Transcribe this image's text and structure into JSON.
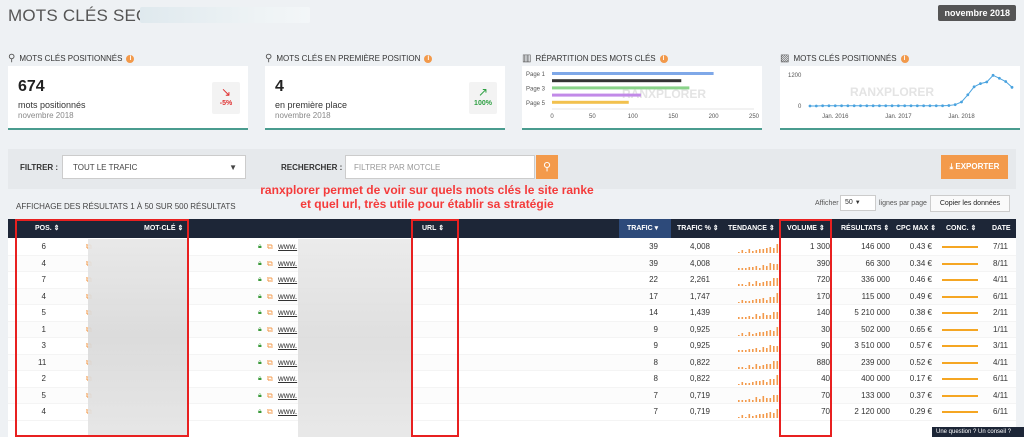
{
  "header": {
    "title": "MOTS CLÉS SEO >",
    "period_badge": "novembre 2018"
  },
  "cards": [
    {
      "title": "MOTS CLÉS POSITIONNÉS",
      "icon": "search-icon",
      "value": "674",
      "label": "mots positionnés",
      "sublabel": "novembre 2018",
      "trend_arrow": "↘",
      "trend_pct": "-5%",
      "trend_color": "#e03030"
    },
    {
      "title": "MOTS CLÉS EN PREMIÈRE POSITION",
      "icon": "search-icon",
      "value": "4",
      "label": "en première place",
      "sublabel": "novembre 2018",
      "trend_arrow": "↗",
      "trend_pct": "100%",
      "trend_color": "#2ea043"
    },
    {
      "title": "RÉPARTITION DES MOTS CLÉS",
      "icon": "bar-chart-icon"
    },
    {
      "title": "MOTS CLÉS POSITIONNÉS",
      "icon": "trend-chart-icon"
    }
  ],
  "chart_data": [
    {
      "type": "bar",
      "orientation": "horizontal",
      "categories": [
        "Page 1",
        "Page 2",
        "Page 3",
        "Page 4",
        "Page 5"
      ],
      "values": [
        200,
        160,
        170,
        110,
        95
      ],
      "colors": [
        "#7fa8e8",
        "#333333",
        "#8ad38a",
        "#c28ae8",
        "#f2c14e"
      ],
      "xticks": [
        "0",
        "50",
        "100",
        "150",
        "200",
        "250"
      ],
      "yticks_shown": [
        "Page 1",
        "Page 3",
        "Page 5"
      ],
      "xlim": [
        0,
        250
      ],
      "watermark": "RANXPLORER"
    },
    {
      "type": "line",
      "x": [
        2015.6,
        2015.7,
        2015.8,
        2015.9,
        2016.0,
        2016.1,
        2016.2,
        2016.3,
        2016.4,
        2016.5,
        2016.6,
        2016.7,
        2016.8,
        2016.9,
        2017.0,
        2017.1,
        2017.2,
        2017.3,
        2017.4,
        2017.5,
        2017.6,
        2017.7,
        2017.8,
        2017.9,
        2018.0,
        2018.1,
        2018.2,
        2018.3,
        2018.4,
        2018.5,
        2018.6,
        2018.7,
        2018.8
      ],
      "values": [
        0,
        0,
        10,
        10,
        10,
        10,
        10,
        10,
        10,
        10,
        10,
        10,
        10,
        10,
        10,
        10,
        10,
        10,
        10,
        10,
        10,
        10,
        20,
        50,
        150,
        420,
        720,
        840,
        900,
        1150,
        1040,
        920,
        700
      ],
      "yticks": [
        "0",
        "1200"
      ],
      "xticks": [
        "Jan. 2016",
        "Jan. 2017",
        "Jan. 2018"
      ],
      "ylim": [
        0,
        1200
      ],
      "color": "#4aa3df",
      "watermark": "RANXPLORER"
    }
  ],
  "filter": {
    "label": "FILTRER :",
    "value": "TOUT LE TRAFIC",
    "search_label": "RECHERCHER :",
    "search_placeholder": "FILTRER PAR MOTCLE",
    "export_label": "EXPORTER"
  },
  "results": {
    "info": "AFFICHAGE DES RÉSULTATS 1 À 50 SUR 500 RÉSULTATS",
    "show_label": "Afficher",
    "per_page": "50",
    "per_page_label": "lignes par page",
    "copy_label": "Copier les données"
  },
  "annotation": {
    "line1": "ranxplorer permet de voir sur quels mots clés le site ranke",
    "line2": "et quel url, très utile pour établir sa stratégie"
  },
  "table": {
    "headers": {
      "pos": "POS. ⇕",
      "keyword": "MOT-CLÉ ⇕",
      "url": "URL ⇕",
      "trafic": "TRAFIC ▾",
      "trafic_pct": "TRAFIC % ⇕",
      "tendance": "TENDANCE ⇕",
      "volume": "VOLUME ⇕",
      "resultats": "RÉSULTATS ⇕",
      "cpc": "CPC MAX ⇕",
      "conc": "CONC. ⇕",
      "date": "DATE ⇕"
    },
    "url_prefix": "www.",
    "rows": [
      {
        "pos": "6",
        "trafic": "39",
        "trafic_pct": "4,008",
        "volume": "1 300",
        "resultats": "146 000",
        "cpc": "0.43 €",
        "conc": 0.9,
        "date": "7/11"
      },
      {
        "pos": "4",
        "trafic": "39",
        "trafic_pct": "4,008",
        "volume": "390",
        "resultats": "66 300",
        "cpc": "0.34 €",
        "conc": 0.9,
        "date": "8/11"
      },
      {
        "pos": "7",
        "trafic": "22",
        "trafic_pct": "2,261",
        "volume": "720",
        "resultats": "336 000",
        "cpc": "0.46 €",
        "conc": 0.9,
        "date": "4/11"
      },
      {
        "pos": "4",
        "trafic": "17",
        "trafic_pct": "1,747",
        "volume": "170",
        "resultats": "115 000",
        "cpc": "0.49 €",
        "conc": 0.9,
        "date": "6/11"
      },
      {
        "pos": "5",
        "trafic": "14",
        "trafic_pct": "1,439",
        "volume": "140",
        "resultats": "5 210 000",
        "cpc": "0.38 €",
        "conc": 0.9,
        "date": "2/11"
      },
      {
        "pos": "1",
        "trafic": "9",
        "trafic_pct": "0,925",
        "volume": "30",
        "resultats": "502 000",
        "cpc": "0.65 €",
        "conc": 0.9,
        "date": "1/11"
      },
      {
        "pos": "3",
        "trafic": "9",
        "trafic_pct": "0,925",
        "volume": "90",
        "resultats": "3 510 000",
        "cpc": "0.57 €",
        "conc": 0.9,
        "date": "3/11"
      },
      {
        "pos": "11",
        "trafic": "8",
        "trafic_pct": "0,822",
        "volume": "880",
        "resultats": "239 000",
        "cpc": "0.52 €",
        "conc": 0.9,
        "date": "4/11"
      },
      {
        "pos": "2",
        "trafic": "8",
        "trafic_pct": "0,822",
        "volume": "40",
        "resultats": "400 000",
        "cpc": "0.17 €",
        "conc": 0.9,
        "date": "6/11"
      },
      {
        "pos": "5",
        "trafic": "7",
        "trafic_pct": "0,719",
        "volume": "70",
        "resultats": "133 000",
        "cpc": "0.37 €",
        "conc": 0.9,
        "date": "4/11"
      },
      {
        "pos": "4",
        "trafic": "7",
        "trafic_pct": "0,719",
        "volume": "70",
        "resultats": "2 120 000",
        "cpc": "0.29 €",
        "conc": 0.9,
        "date": "6/11"
      }
    ]
  },
  "help_tab": "Une question ? Un conseil ?"
}
